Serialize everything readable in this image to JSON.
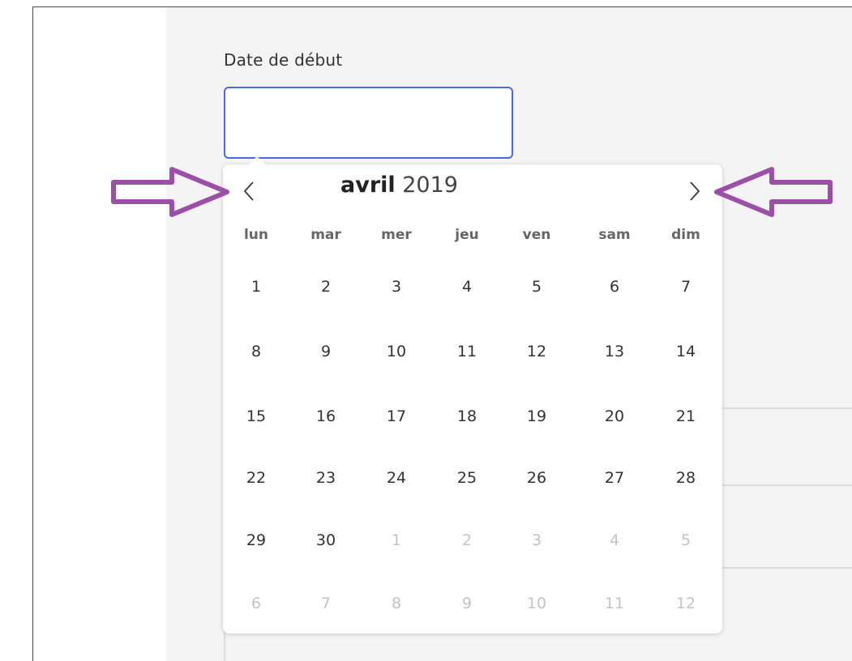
{
  "form": {
    "start_label": "Date de début",
    "start_value": ""
  },
  "calendar": {
    "month": "avril",
    "year": "2019",
    "weekdays": [
      "lun",
      "mar",
      "mer",
      "jeu",
      "ven",
      "sam",
      "dim"
    ],
    "weeks": [
      [
        {
          "d": "1",
          "muted": false
        },
        {
          "d": "2",
          "muted": false
        },
        {
          "d": "3",
          "muted": false
        },
        {
          "d": "4",
          "muted": false
        },
        {
          "d": "5",
          "muted": false
        },
        {
          "d": "6",
          "muted": false
        },
        {
          "d": "7",
          "muted": false
        }
      ],
      [
        {
          "d": "8",
          "muted": false
        },
        {
          "d": "9",
          "muted": false
        },
        {
          "d": "10",
          "muted": false
        },
        {
          "d": "11",
          "muted": false
        },
        {
          "d": "12",
          "muted": false
        },
        {
          "d": "13",
          "muted": false
        },
        {
          "d": "14",
          "muted": false
        }
      ],
      [
        {
          "d": "15",
          "muted": false
        },
        {
          "d": "16",
          "muted": false
        },
        {
          "d": "17",
          "muted": false
        },
        {
          "d": "18",
          "muted": false
        },
        {
          "d": "19",
          "muted": false
        },
        {
          "d": "20",
          "muted": false
        },
        {
          "d": "21",
          "muted": false
        }
      ],
      [
        {
          "d": "22",
          "muted": false
        },
        {
          "d": "23",
          "muted": false
        },
        {
          "d": "24",
          "muted": false
        },
        {
          "d": "25",
          "muted": false
        },
        {
          "d": "26",
          "muted": false
        },
        {
          "d": "27",
          "muted": false
        },
        {
          "d": "28",
          "muted": false
        }
      ],
      [
        {
          "d": "29",
          "muted": false
        },
        {
          "d": "30",
          "muted": false
        },
        {
          "d": "1",
          "muted": true
        },
        {
          "d": "2",
          "muted": true
        },
        {
          "d": "3",
          "muted": true
        },
        {
          "d": "4",
          "muted": true
        },
        {
          "d": "5",
          "muted": true
        }
      ],
      [
        {
          "d": "6",
          "muted": true
        },
        {
          "d": "7",
          "muted": true
        },
        {
          "d": "8",
          "muted": true
        },
        {
          "d": "9",
          "muted": true
        },
        {
          "d": "10",
          "muted": true
        },
        {
          "d": "11",
          "muted": true
        },
        {
          "d": "12",
          "muted": true
        }
      ]
    ],
    "prev_icon": "chevron-left-icon",
    "next_icon": "chevron-right-icon"
  },
  "annotations": {
    "arrow_color": "#9b4fa6",
    "left_arrow_icon": "arrow-right-outline-icon",
    "right_arrow_icon": "arrow-left-outline-icon"
  },
  "colors": {
    "input_border": "#4a6be0",
    "muted_day": "#c4c4c4"
  }
}
